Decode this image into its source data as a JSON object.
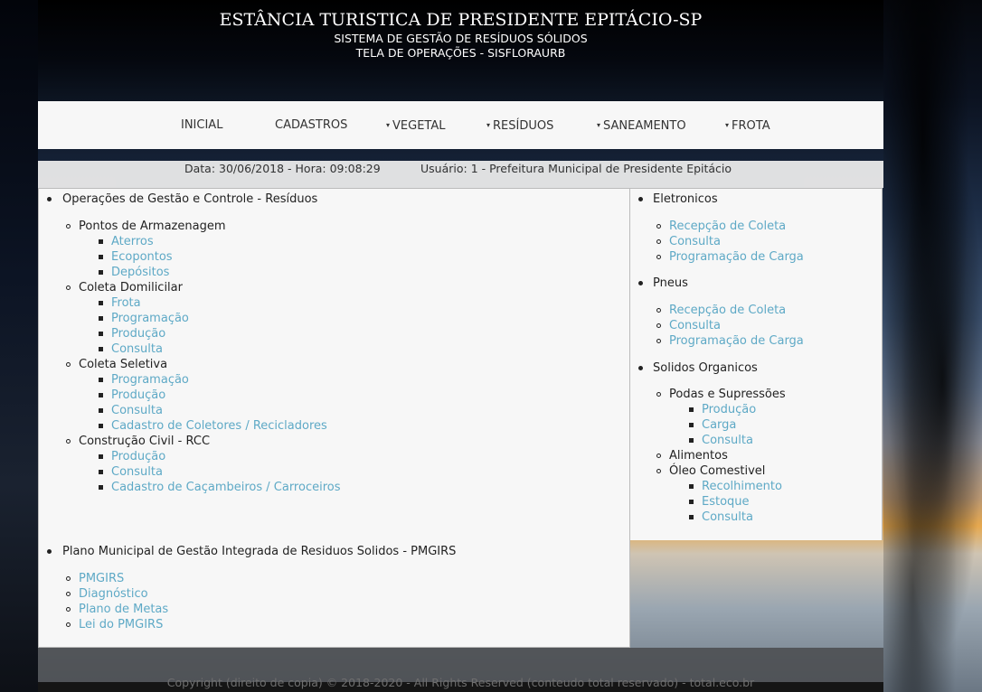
{
  "header": {
    "title": "ESTÂNCIA TURISTICA DE PRESIDENTE EPITÁCIO-SP",
    "subtitle": "SISTEMA DE GESTÃO DE RESÍDUOS SÓLIDOS",
    "screen": "TELA DE OPERAÇÕES - SISFLORAURB"
  },
  "nav": {
    "items": [
      {
        "label": "INICIAL",
        "dropdown": false
      },
      {
        "label": "CADASTROS",
        "dropdown": false
      },
      {
        "label": "VEGETAL",
        "dropdown": true
      },
      {
        "label": "RESÍDUOS",
        "dropdown": true
      },
      {
        "label": "SANEAMENTO",
        "dropdown": true
      },
      {
        "label": "FROTA",
        "dropdown": true
      }
    ],
    "caret": "▾"
  },
  "info": {
    "datetime": "Data: 30/06/2018 - Hora: 09:08:29",
    "user": "Usuário: 1 - Prefeitura Municipal de Presidente Epitácio"
  },
  "left": {
    "title": "Operações de Gestão e Controle - Resíduos",
    "groups": [
      {
        "label": "Pontos de Armazenagem",
        "links": [
          "Aterros",
          "Ecopontos",
          "Depósitos"
        ]
      },
      {
        "label": "Coleta Domilicilar",
        "links": [
          "Frota",
          "Programação",
          "Produção",
          "Consulta"
        ]
      },
      {
        "label": "Coleta Seletiva",
        "links": [
          "Programação",
          "Produção",
          "Consulta",
          "Cadastro de Coletores / Recicladores"
        ]
      },
      {
        "label": "Construção Civil - RCC",
        "links": [
          "Produção",
          "Consulta",
          "Cadastro de Caçambeiros / Carroceiros"
        ]
      }
    ]
  },
  "right": {
    "eletronicos": {
      "title": "Eletronicos",
      "links": [
        "Recepção de Coleta",
        "Consulta",
        "Programação de Carga"
      ]
    },
    "pneus": {
      "title": "Pneus",
      "links": [
        "Recepção de Coleta",
        "Consulta",
        "Programação de Carga"
      ]
    },
    "organicos": {
      "title": "Solidos Organicos",
      "podas": {
        "label": "Podas e Supressões",
        "links": [
          "Produção",
          "Carga",
          "Consulta"
        ]
      },
      "alimentos": "Alimentos",
      "oleo": {
        "label": "Óleo Comestivel",
        "links": [
          "Recolhimento",
          "Estoque",
          "Consulta"
        ]
      }
    }
  },
  "pmgirs": {
    "title": "Plano Municipal de Gestão Integrada de Residuos Solidos - PMGIRS",
    "links": [
      "PMGIRS",
      "Diagnóstico",
      "Plano de Metas",
      "Lei do PMGIRS"
    ]
  },
  "footer": {
    "text": "Copyright (direito de copia) © 2018-2020 - All Rights Reserved (conteudo total reservado) - total.eco.br"
  },
  "colors": {
    "link": "#5ea9c6",
    "panel": "#f7f7f7",
    "nav": "#f7f7f7"
  }
}
